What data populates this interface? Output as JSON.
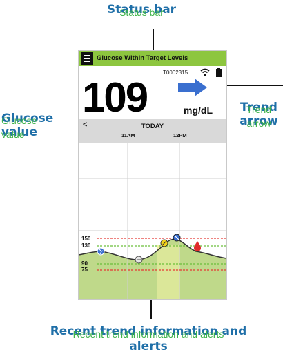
{
  "callouts": {
    "status_bar": "Status bar",
    "glucose_value": "Glucose value",
    "trend_arrow": "Trend arrow",
    "recent_trend": "Recent trend information and alerts"
  },
  "screen": {
    "status_text": "Glucose Within Target Levels",
    "transmitter_id": "T0002315",
    "glucose_value": "109",
    "unit": "mg/dL",
    "day_label": "TODAY",
    "back_label": "<",
    "hours": [
      "11AM",
      "12PM"
    ],
    "trend_direction": "right"
  },
  "colors": {
    "status_bar": "#8dc63f",
    "trend_arrow": "#3a6fcf",
    "callout_text": "#1f6fa8",
    "callout_overlay": "#3eb34a",
    "high_line": "#e53935",
    "low_line": "#e53935",
    "target_line": "#6bbf3a",
    "trend_fill": "#bfd98a",
    "highlight": "#f3f2a6"
  },
  "chart_data": {
    "type": "line",
    "y_ticks": [
      "150",
      "130",
      "90",
      "75"
    ],
    "threshold_lines": [
      {
        "value": 150,
        "style": "dashed",
        "color": "red"
      },
      {
        "value": 130,
        "style": "dashed",
        "color": "green"
      },
      {
        "value": 90,
        "style": "dashed",
        "color": "green"
      },
      {
        "value": 75,
        "style": "dashed",
        "color": "red"
      }
    ],
    "x_labels": [
      "11AM",
      "12PM"
    ],
    "event_markers": [
      "exercise-icon",
      "meal-icon",
      "insulin-icon",
      "syringe-icon",
      "blood-drop-icon"
    ]
  }
}
